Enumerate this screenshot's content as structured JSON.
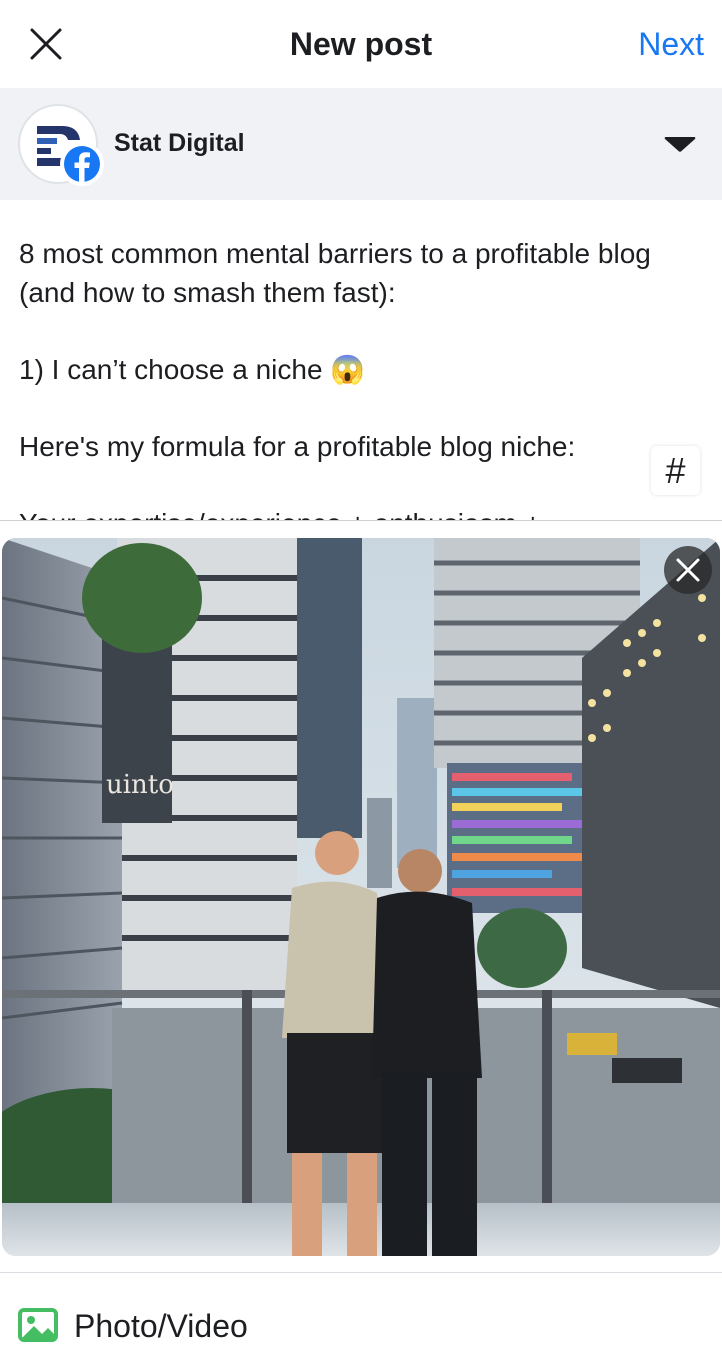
{
  "header": {
    "close_icon": "close-icon",
    "title": "New post",
    "next_label": "Next"
  },
  "account": {
    "name": "Stat Digital",
    "avatar_icon": "stat-digital-logo",
    "badge_icon": "facebook-icon",
    "dropdown_icon": "caret-down-icon",
    "brand_color": "#24356b",
    "badge_color": "#1877f2"
  },
  "post": {
    "line1": "8 most common mental barriers to a profitable blog (and how to smash them fast):",
    "line2": "1) I can’t choose a niche 😱",
    "line3": "Here's my formula for a profitable blog niche:",
    "line4": "Your expertise/experience + enthusiasm +",
    "hashtag_label": "#"
  },
  "photo": {
    "remove_icon": "close-icon",
    "alt": "",
    "sign_text": "uinto"
  },
  "actions": {
    "photo_video_label": "Photo/Video",
    "photo_video_icon": "photo-icon",
    "photo_video_color": "#45bd62"
  },
  "colors": {
    "accent": "#1877f2",
    "account_bar_bg": "#f0f2f5",
    "text": "#1c1e21"
  }
}
